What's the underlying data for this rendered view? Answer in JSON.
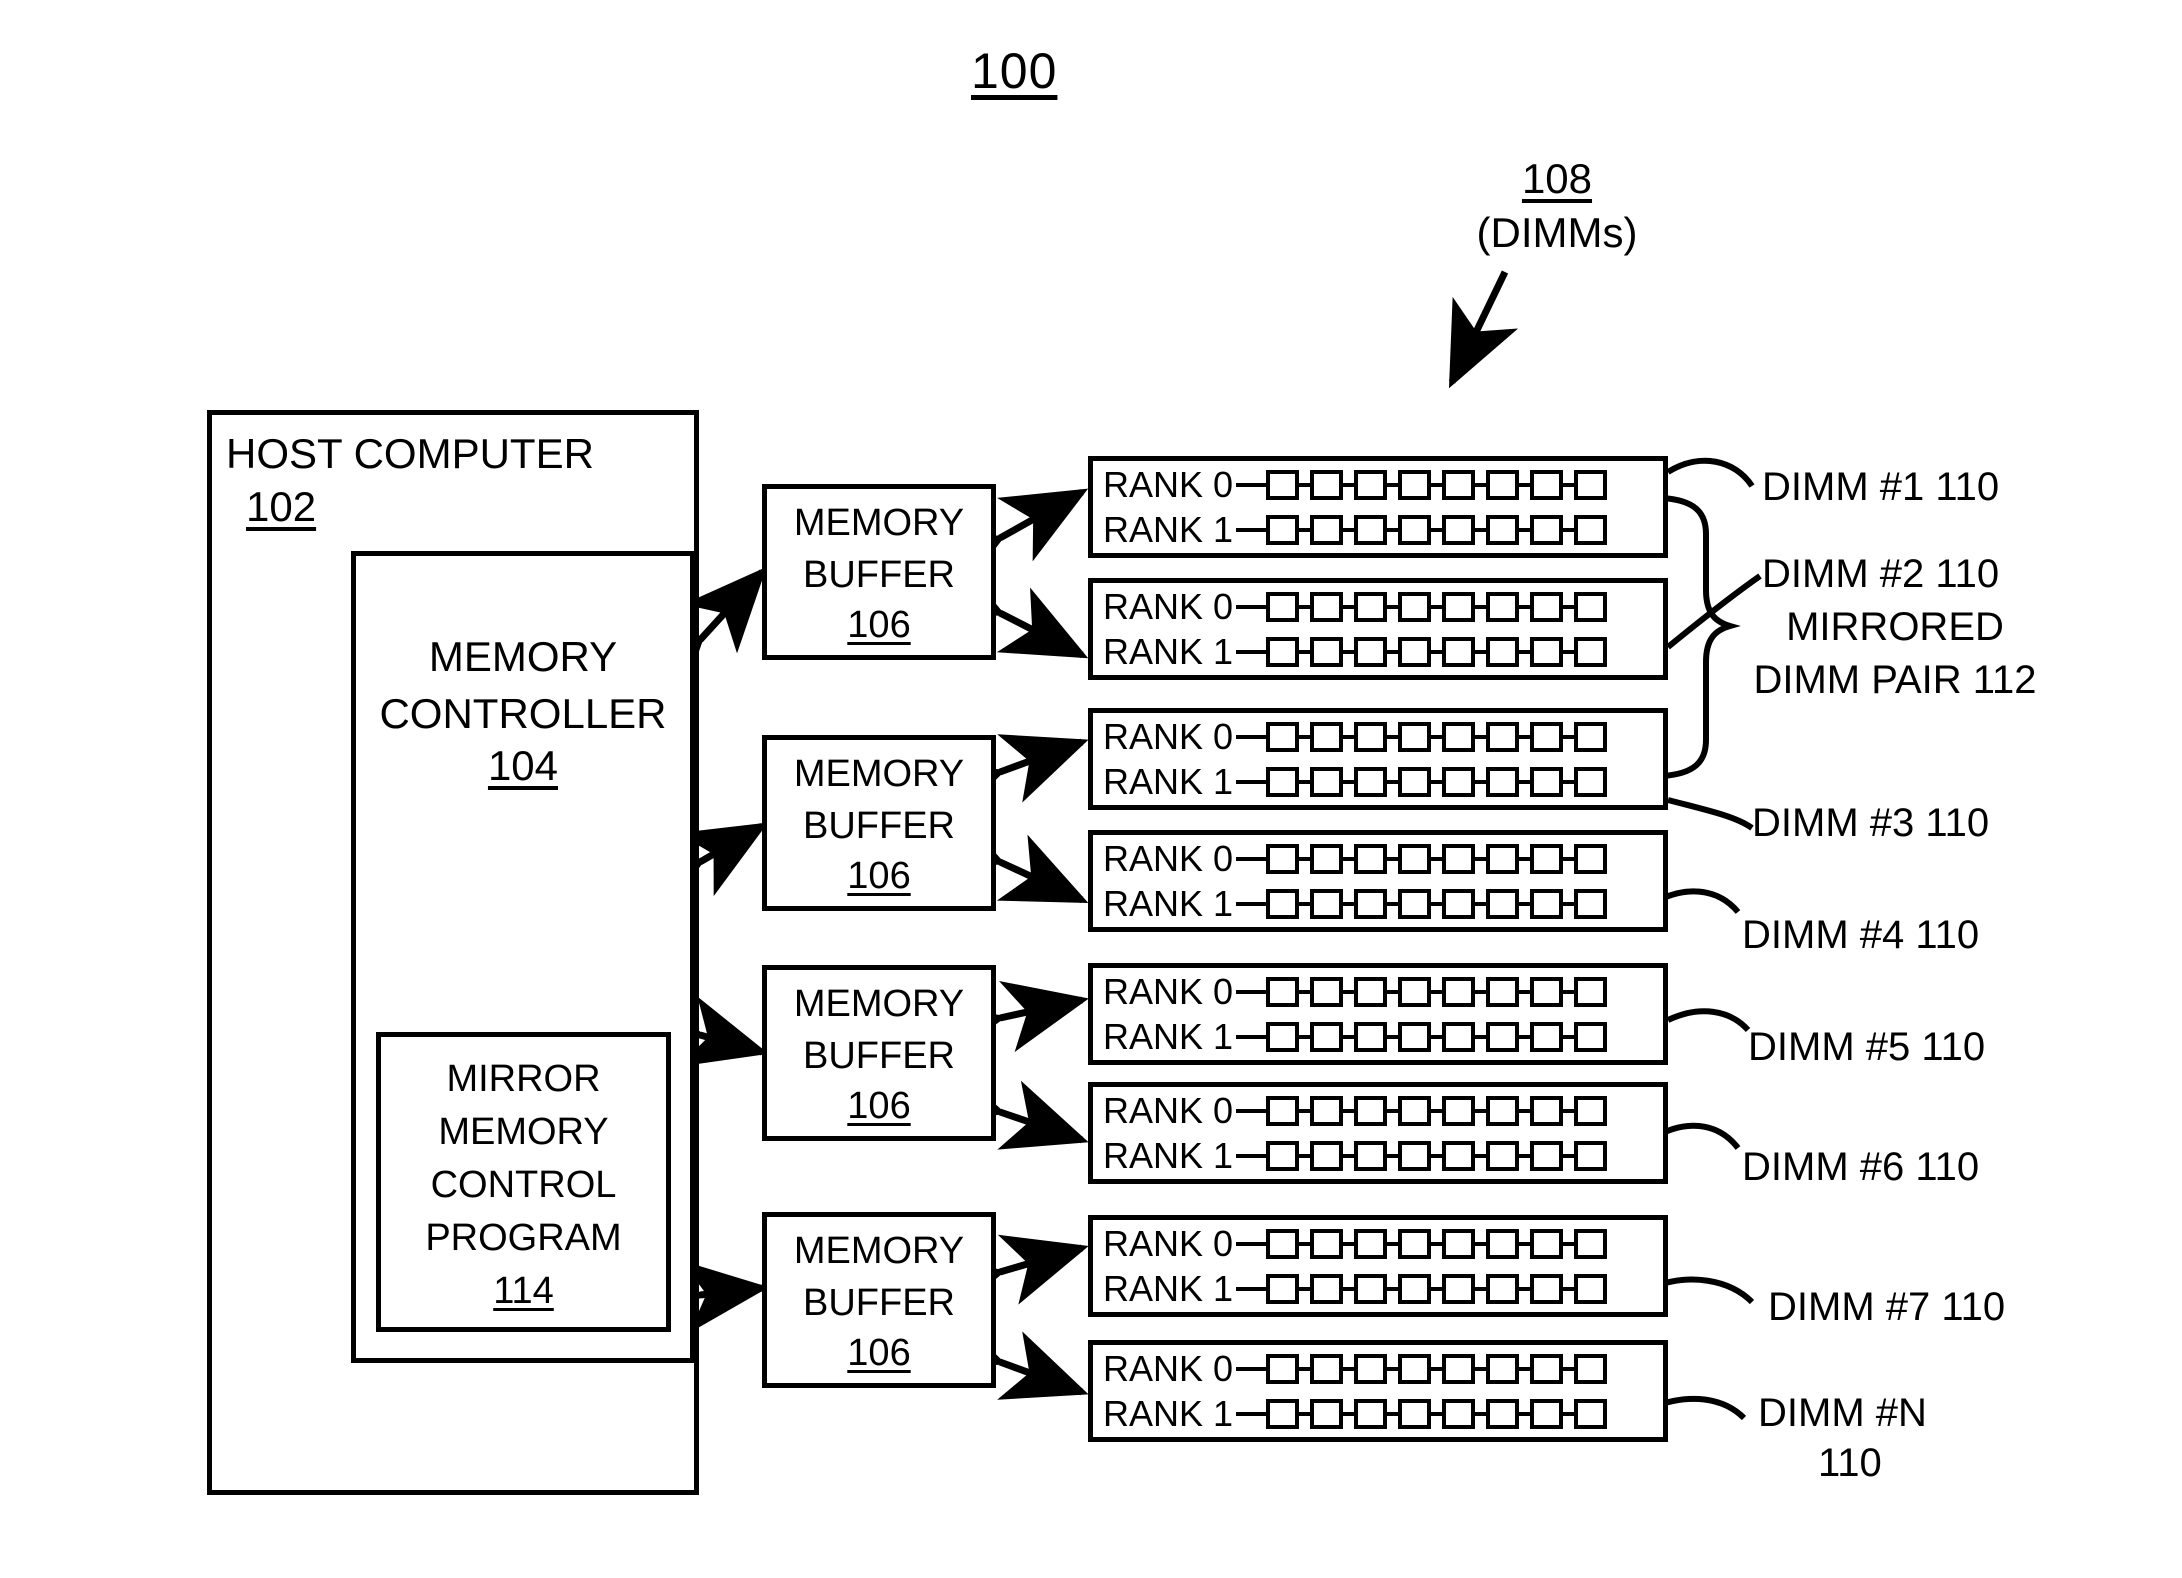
{
  "figure": {
    "number": "100"
  },
  "annotations": {
    "dimms_group": {
      "ref": "108",
      "label": "(DIMMs)"
    }
  },
  "host_computer": {
    "title": "HOST COMPUTER",
    "ref": "102",
    "memory_controller": {
      "title_line1": "MEMORY",
      "title_line2": "CONTROLLER",
      "ref": "104",
      "mirror_program": {
        "line1": "MIRROR",
        "line2": "MEMORY",
        "line3": "CONTROL",
        "line4": "PROGRAM",
        "ref": "114"
      }
    }
  },
  "memory_buffers": [
    {
      "title_line1": "MEMORY",
      "title_line2": "BUFFER",
      "ref": "106"
    },
    {
      "title_line1": "MEMORY",
      "title_line2": "BUFFER",
      "ref": "106"
    },
    {
      "title_line1": "MEMORY",
      "title_line2": "BUFFER",
      "ref": "106"
    },
    {
      "title_line1": "MEMORY",
      "title_line2": "BUFFER",
      "ref": "106"
    }
  ],
  "dimms": [
    {
      "rank0": "RANK 0",
      "rank1": "RANK 1",
      "chips_per_rank": 8
    },
    {
      "rank0": "RANK 0",
      "rank1": "RANK 1",
      "chips_per_rank": 8
    },
    {
      "rank0": "RANK 0",
      "rank1": "RANK 1",
      "chips_per_rank": 8
    },
    {
      "rank0": "RANK 0",
      "rank1": "RANK 1",
      "chips_per_rank": 8
    },
    {
      "rank0": "RANK 0",
      "rank1": "RANK 1",
      "chips_per_rank": 8
    },
    {
      "rank0": "RANK 0",
      "rank1": "RANK 1",
      "chips_per_rank": 8
    },
    {
      "rank0": "RANK 0",
      "rank1": "RANK 1",
      "chips_per_rank": 8
    },
    {
      "rank0": "RANK 0",
      "rank1": "RANK 1",
      "chips_per_rank": 8
    }
  ],
  "dimm_labels": {
    "dimm1": "DIMM #1 110",
    "dimm2": "DIMM #2 110",
    "mirrored_line1": "MIRRORED",
    "mirrored_line2": "DIMM PAIR 112",
    "dimm3": "DIMM #3 110",
    "dimm4": "DIMM #4 110",
    "dimm5": "DIMM #5 110",
    "dimm6": "DIMM #6 110",
    "dimm7": "DIMM #7 110",
    "dimmN_line1": "DIMM #N",
    "dimmN_line2": "110"
  },
  "colors": {
    "stroke": "#000000",
    "background": "#ffffff"
  }
}
